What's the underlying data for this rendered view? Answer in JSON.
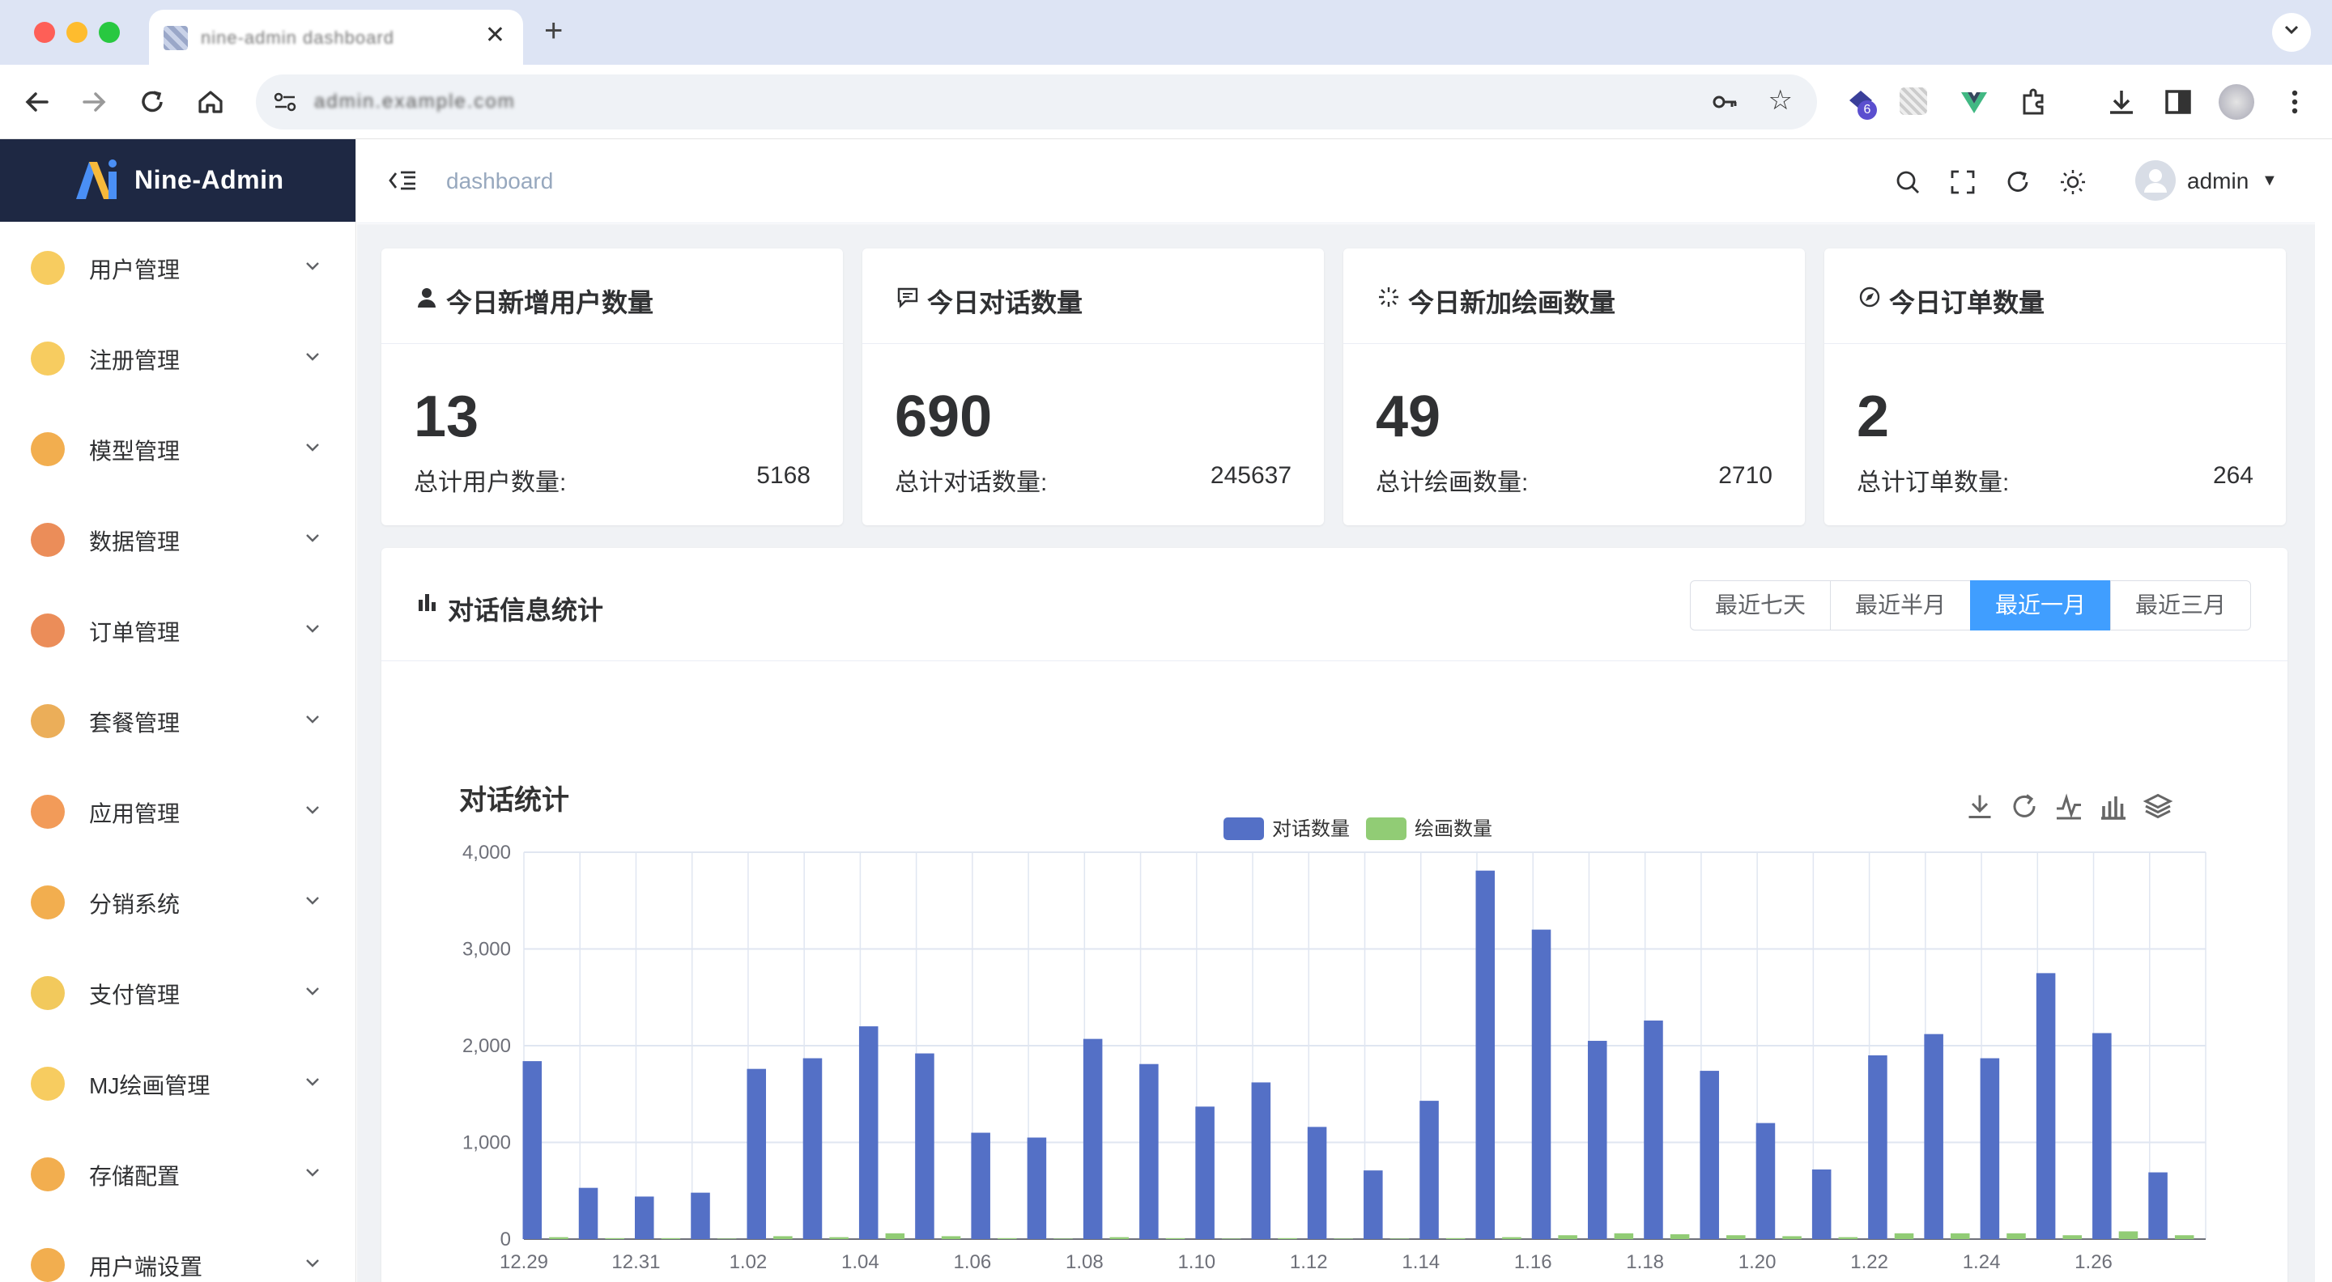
{
  "browser": {
    "tab_title": "nine-admin dashboard",
    "new_tab": "+",
    "close": "✕",
    "url": "admin.example.com",
    "extension_badge": "6"
  },
  "app": {
    "name": "Nine-Admin",
    "breadcrumb": "dashboard",
    "user": "admin"
  },
  "sidebar": {
    "items": [
      {
        "label": "用户管理",
        "icon": "user-card-icon",
        "color": "#f6c344"
      },
      {
        "label": "注册管理",
        "icon": "person-icon",
        "color": "#f6c344"
      },
      {
        "label": "模型管理",
        "icon": "cube-icon",
        "color": "#f0a030"
      },
      {
        "label": "数据管理",
        "icon": "chat-icon",
        "color": "#e8793c"
      },
      {
        "label": "订单管理",
        "icon": "clipboard-icon",
        "color": "#e8793c"
      },
      {
        "label": "套餐管理",
        "icon": "cards-icon",
        "color": "#e8a03c"
      },
      {
        "label": "应用管理",
        "icon": "apps-icon",
        "color": "#f08a3c"
      },
      {
        "label": "分销系统",
        "icon": "send-icon",
        "color": "#f0a030"
      },
      {
        "label": "支付管理",
        "icon": "cashier-icon",
        "color": "#f0c040"
      },
      {
        "label": "MJ绘画管理",
        "icon": "palette-icon",
        "color": "#f6c344"
      },
      {
        "label": "存储配置",
        "icon": "storage-icon",
        "color": "#f0a030"
      },
      {
        "label": "用户端设置",
        "icon": "settings-card-icon",
        "color": "#f0a030"
      }
    ]
  },
  "stats": [
    {
      "title": "今日新增用户数量",
      "icon": "user-icon",
      "value": "13",
      "total_label": "总计用户数量:",
      "total_value": "5168"
    },
    {
      "title": "今日对话数量",
      "icon": "message-icon",
      "value": "690",
      "total_label": "总计对话数量:",
      "total_value": "245637"
    },
    {
      "title": "今日新加绘画数量",
      "icon": "loading-icon",
      "value": "49",
      "total_label": "总计绘画数量:",
      "total_value": "2710"
    },
    {
      "title": "今日订单数量",
      "icon": "compass-icon",
      "value": "2",
      "total_label": "总计订单数量:",
      "total_value": "264"
    }
  ],
  "chart_card": {
    "title": "对话信息统计",
    "ranges": [
      "最近七天",
      "最近半月",
      "最近一月",
      "最近三月"
    ],
    "active_range": "最近一月"
  },
  "chart_data": {
    "type": "bar",
    "title": "对话统计",
    "categories": [
      "12.29",
      "12.30",
      "12.31",
      "1.01",
      "1.02",
      "1.03",
      "1.04",
      "1.05",
      "1.06",
      "1.07",
      "1.08",
      "1.09",
      "1.10",
      "1.11",
      "1.12",
      "1.13",
      "1.14",
      "1.15",
      "1.16",
      "1.17",
      "1.18",
      "1.19",
      "1.20",
      "1.21",
      "1.22",
      "1.23",
      "1.24",
      "1.25",
      "1.26",
      "1.27"
    ],
    "series": [
      {
        "name": "对话数量",
        "color": "#5470c6",
        "values": [
          1840,
          530,
          440,
          480,
          1760,
          1870,
          2200,
          1920,
          1100,
          1050,
          2070,
          1810,
          1370,
          1620,
          1160,
          710,
          1430,
          3810,
          3200,
          2050,
          2260,
          1740,
          1200,
          720,
          1900,
          2120,
          1870,
          2750,
          2130,
          690
        ]
      },
      {
        "name": "绘画数量",
        "color": "#91cc75",
        "values": [
          20,
          10,
          10,
          5,
          30,
          20,
          60,
          30,
          10,
          5,
          20,
          10,
          5,
          10,
          5,
          5,
          10,
          20,
          40,
          60,
          50,
          40,
          30,
          20,
          60,
          60,
          60,
          40,
          80,
          40
        ]
      }
    ],
    "y_ticks": [
      "0",
      "1,000",
      "2,000",
      "3,000",
      "4,000"
    ],
    "x_tick_labels": [
      "12.29",
      "12.31",
      "1.02",
      "1.04",
      "1.06",
      "1.08",
      "1.10",
      "1.12",
      "1.14",
      "1.16",
      "1.18",
      "1.20",
      "1.22",
      "1.24",
      "1.26"
    ],
    "ylim": [
      0,
      4000
    ],
    "legend_position": "top-center",
    "grid": true,
    "toolbox": [
      "download-icon",
      "refresh-icon",
      "line-chart-icon",
      "bar-chart-icon",
      "stack-icon"
    ]
  }
}
